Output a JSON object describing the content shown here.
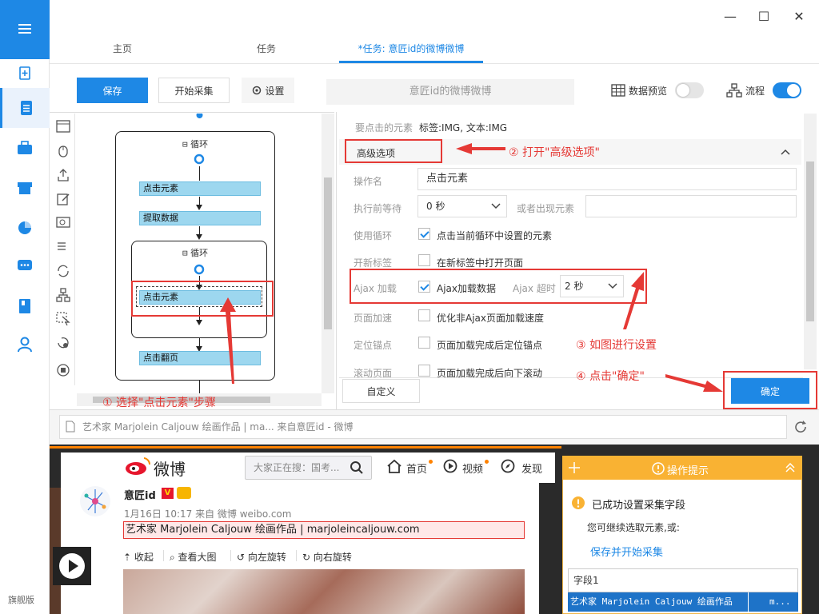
{
  "window": {
    "minimize": "—",
    "maximize": "☐",
    "close": "✕"
  },
  "leftnav": {
    "bottom_label": "旗舰版"
  },
  "tabs": [
    {
      "label": "主页"
    },
    {
      "label": "任务"
    },
    {
      "label": "*任务: 意匠id的微博微博"
    }
  ],
  "toolbar": {
    "save": "保存",
    "start": "开始采集",
    "settings": "设置",
    "task_name": "意匠id的微博微博",
    "data_preview": "数据预览",
    "flow": "流程"
  },
  "flow": {
    "loop1": "循环",
    "click1": "点击元素",
    "extract": "提取数据",
    "loop2": "循环",
    "click2": "点击元素",
    "next_page": "点击翻页"
  },
  "panel": {
    "target_label": "要点击的元素",
    "target_value": "标签:IMG, 文本:IMG",
    "advanced": "高级选项",
    "op_name_label": "操作名",
    "op_name_value": "点击元素",
    "wait_label": "执行前等待",
    "wait_value": "0 秒",
    "or_appear_label": "或者出现元素",
    "use_loop_label": "使用循环",
    "use_loop_text": "点击当前循环中设置的元素",
    "new_tab_label": "开新标签",
    "new_tab_text": "在新标签中打开页面",
    "ajax_label": "Ajax 加载",
    "ajax_text": "Ajax加载数据",
    "ajax_timeout_label": "Ajax 超时",
    "ajax_timeout_value": "2 秒",
    "page_speed_label": "页面加速",
    "page_speed_text": "优化非Ajax页面加载速度",
    "anchor_label": "定位锚点",
    "anchor_text": "页面加载完成后定位锚点",
    "scroll_label": "滚动页面",
    "scroll_text": "页面加载完成后向下滚动",
    "custom": "自定义",
    "confirm": "确定"
  },
  "annotations": {
    "step1": "① 选择\"点击元素\"步骤",
    "step2": "② 打开\"高级选项\"",
    "step3": "③ 如图进行设置",
    "step4": "④ 点击\"确定\""
  },
  "browser": {
    "address": "艺术家 Marjolein Caljouw 绘画作品 | ma... 来自意匠id - 微博",
    "weibo_logo": "微博",
    "search_placeholder": "大家正在搜：国考...",
    "nav_home": "首页",
    "nav_video": "视频",
    "nav_discover": "发现",
    "post_user": "意匠id",
    "post_meta": "1月16日 10:17 来自 微博 weibo.com",
    "post_text": "艺术家 Marjolein Caljouw 绘画作品 | marjoleincaljouw.com",
    "action_collapse": "收起",
    "action_big": "查看大图",
    "action_left": "向左旋转",
    "action_right": "向右旋转"
  },
  "tips": {
    "title": "操作提示",
    "success": "已成功设置采集字段",
    "continue": "您可继续选取元素,或:",
    "save_start": "保存并开始采集",
    "field_name": "字段1",
    "field_value": "艺术家 Marjolein Caljouw 绘画作品",
    "field_more": "m..."
  },
  "colors": {
    "accent": "#1e88e5",
    "annotation": "#e53935",
    "tips_header": "#f9b233"
  }
}
